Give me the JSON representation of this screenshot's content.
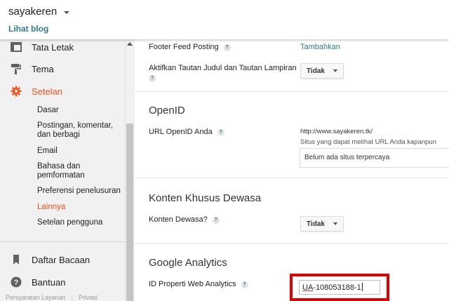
{
  "header": {
    "blog_name": "sayakeren",
    "view_blog_label": "Lihat blog"
  },
  "sidebar": {
    "main_items": [
      {
        "label": "Tata Letak",
        "icon": "layout-icon"
      },
      {
        "label": "Tema",
        "icon": "paint-roller-icon"
      },
      {
        "label": "Setelan",
        "icon": "gear-icon",
        "active": true
      }
    ],
    "sub_items": [
      {
        "label": "Dasar"
      },
      {
        "label": "Postingan, komentar, dan berbagi"
      },
      {
        "label": "Email"
      },
      {
        "label": "Bahasa dan pemformatan"
      },
      {
        "label": "Preferensi penelusuran"
      },
      {
        "label": "Lainnya",
        "active": true
      },
      {
        "label": "Setelan pengguna"
      }
    ],
    "bottom_items": [
      {
        "label": "Daftar Bacaan",
        "icon": "bookmark-icon"
      },
      {
        "label": "Bantuan",
        "icon": "help-circle-icon"
      }
    ],
    "footer_links": [
      "Persyaratan Layanan",
      "Privasi"
    ]
  },
  "settings": {
    "footer_feed": {
      "label": "Footer Feed Posting",
      "action": "Tambahkan"
    },
    "title_links": {
      "label": "Aktifkan Tautan Judul dan Tautan Lampiran",
      "value": "Tidak"
    },
    "openid": {
      "title": "OpenID",
      "url_label": "URL OpenID Anda",
      "url": "http://www.sayakeren.tk/",
      "hint": "Situs yang dapat melihat URL Anda kapanpun",
      "trusted": "Belum ada situs terpercaya"
    },
    "adult": {
      "title": "Konten Khusus Dewasa",
      "label": "Konten Dewasa?",
      "value": "Tidak"
    },
    "analytics": {
      "title": "Google Analytics",
      "label": "ID Properti Web Analytics",
      "value_prefix": "UA",
      "value_rest": "-108053188-1"
    }
  },
  "colors": {
    "accent": "#f4511e",
    "link": "#2c7a8a",
    "highlight": "#e00000"
  }
}
